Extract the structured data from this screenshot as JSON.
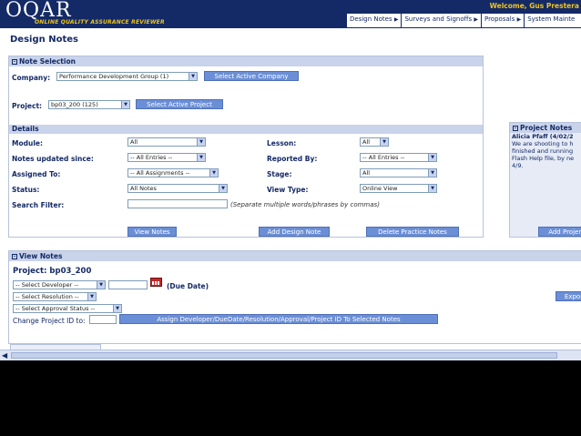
{
  "header": {
    "logo_text": "OQAR",
    "logo_tagline": "ONLINE QUALITY ASSURANCE REVIEWER",
    "welcome": "Welcome, Gus Prestera"
  },
  "nav": {
    "items": [
      "Design Notes",
      "Surveys and Signoffs",
      "Proposals",
      "System Mainte"
    ]
  },
  "page_title": "Design Notes",
  "note_selection": {
    "heading": "Note Selection",
    "company_label": "Company:",
    "company_value": "Performance Development Group (1)",
    "select_company_button": "Select Active Company",
    "project_label": "Project:",
    "project_value": "bp03_200 (125)",
    "select_project_button": "Select Active Project"
  },
  "details": {
    "heading": "Details",
    "module_label": "Module:",
    "module_value": "All",
    "lesson_label": "Lesson:",
    "lesson_value": "All",
    "notes_updated_label": "Notes updated since:",
    "notes_updated_value": "-- All Entries --",
    "reported_by_label": "Reported By:",
    "reported_by_value": "-- All Entries --",
    "assigned_to_label": "Assigned To:",
    "assigned_to_value": "-- All Assignments --",
    "stage_label": "Stage:",
    "stage_value": "All",
    "status_label": "Status:",
    "status_value": "All Notes",
    "view_type_label": "View Type:",
    "view_type_value": "Online View",
    "search_filter_label": "Search Filter:",
    "search_hint": "(Separate multiple words/phrases by commas)",
    "view_notes_button": "View Notes",
    "add_design_note_button": "Add Design Note",
    "delete_practice_button": "Delete Practice Notes"
  },
  "project_notes": {
    "heading": "Project Notes",
    "author": "Alicia Pfaff (4/02/2",
    "lines": [
      "We are shooting to h",
      "finished and running",
      "Flash Help file, by ne",
      "4/9."
    ],
    "add_button": "Add Projen"
  },
  "view_notes": {
    "heading": "View Notes",
    "project_title": "Project: bp03_200",
    "developer_select": "-- Select Developer --",
    "due_date_label": "(Due Date)",
    "resolution_select": "-- Select Resolution --",
    "approval_select": "-- Select Approval Status --",
    "change_project_label": "Change Project ID to:",
    "assign_button": "Assign Developer/DueDate/Resolution/Approval/Project ID To Selected Notes",
    "export_button": "Expor"
  }
}
